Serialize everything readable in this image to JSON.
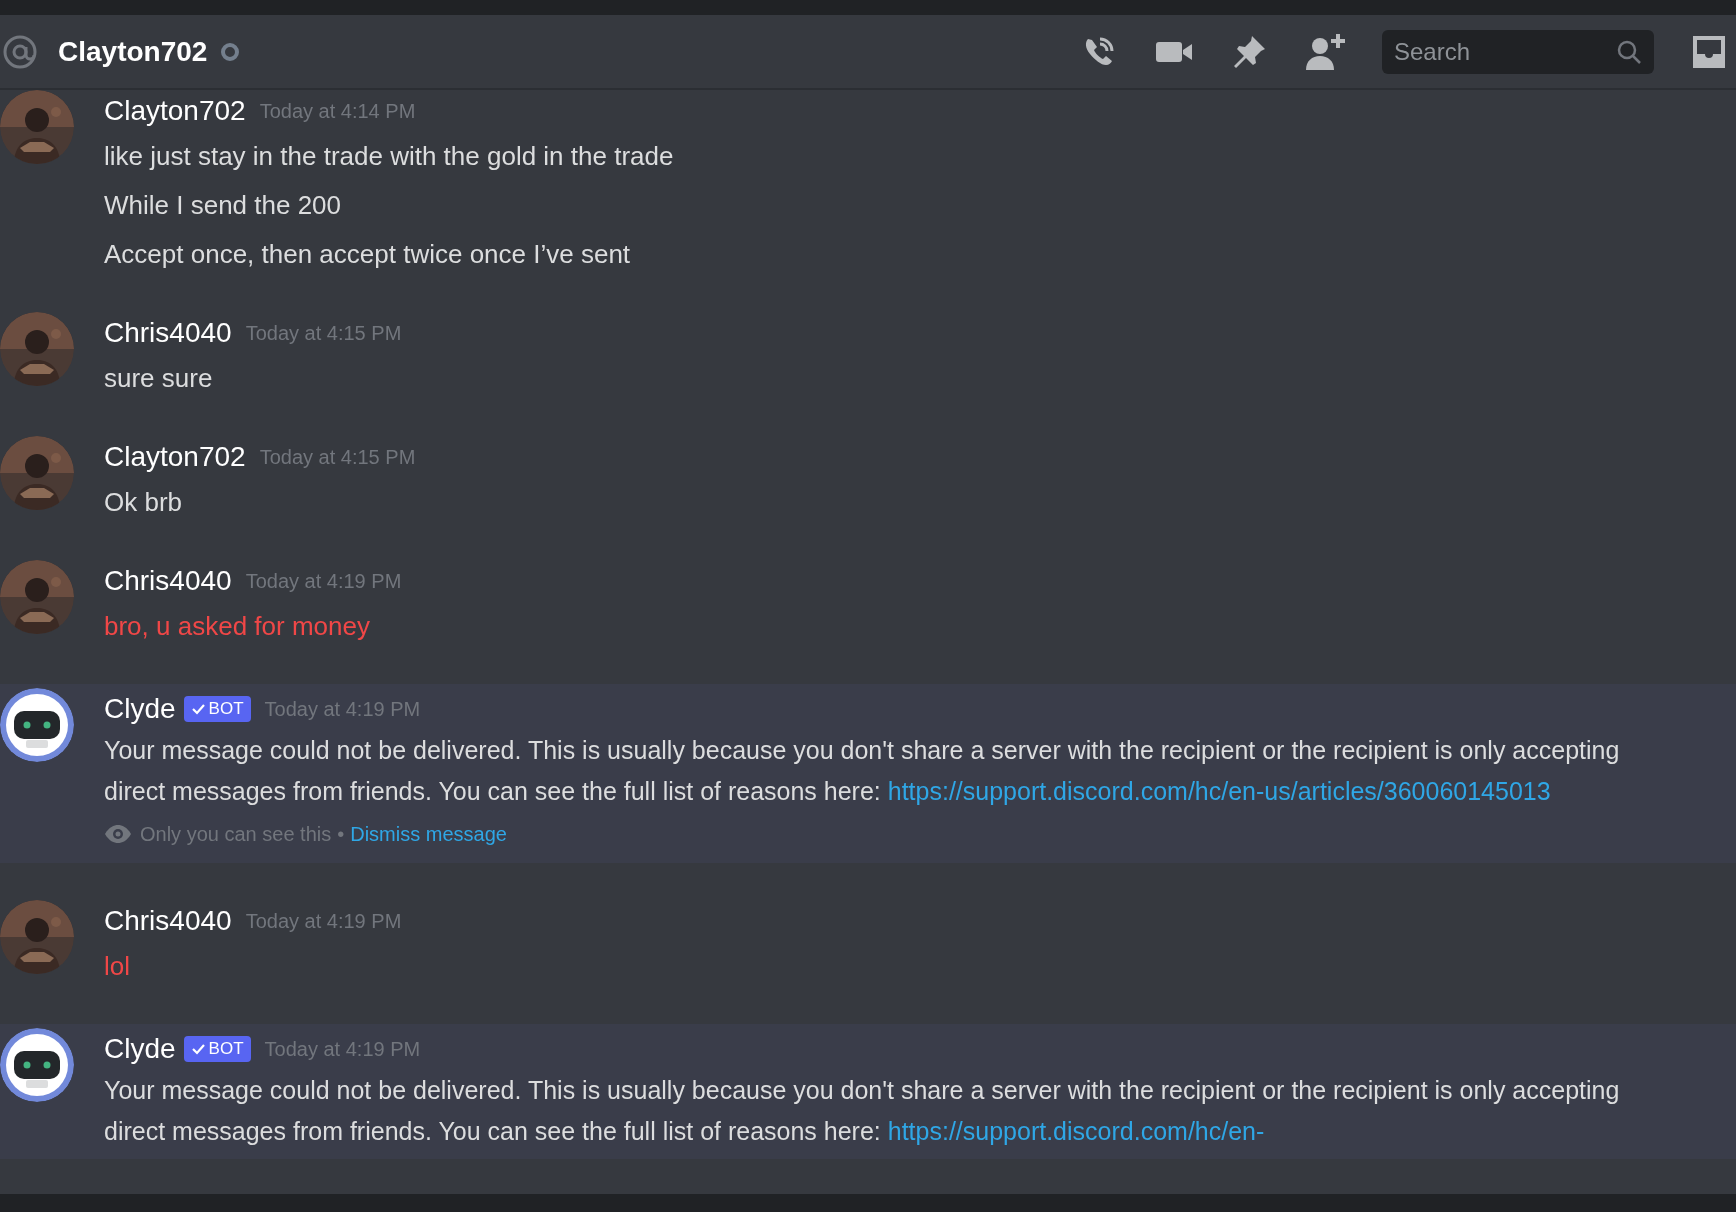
{
  "header": {
    "title": "Clayton702",
    "online": false,
    "search": {
      "placeholder": "Search"
    }
  },
  "messages": [
    {
      "author": "Clayton702",
      "time": "Today at 4:14 PM",
      "lines": [
        {
          "text": "like just stay in the trade with the gold in the trade"
        },
        {
          "text": "While I send the 200"
        },
        {
          "text": "Accept once, then accept twice once I’ve sent"
        }
      ]
    },
    {
      "author": "Chris4040",
      "time": "Today at 4:15 PM",
      "lines": [
        {
          "text": "sure sure"
        }
      ]
    },
    {
      "author": "Clayton702",
      "time": "Today at 4:15 PM",
      "lines": [
        {
          "text": "Ok brb"
        }
      ]
    },
    {
      "author": "Chris4040",
      "time": "Today at 4:19 PM",
      "lines": [
        {
          "text": "bro, u asked for money",
          "color": "#f04747"
        }
      ]
    },
    {
      "author": "Clyde",
      "avatar": {
        "kind": "bot"
      },
      "badge": "BOT",
      "time": "Today at 4:19 PM",
      "text": "Your message could not be delivered. This is usually because you don't share a server with the recipient or the recipient is only accepting direct messages from friends. You can see the full list of reasons here:",
      "link": "https://support.discord.com/hc/en-us/articles/360060145013",
      "ephemeral": {
        "text": "Only you can see this",
        "separator": "•",
        "action": "Dismiss message"
      }
    },
    {
      "author": "Chris4040",
      "time": "Today at 4:19 PM",
      "lines": [
        {
          "text": "lol",
          "color": "#f04747"
        }
      ]
    },
    {
      "author": "Clyde",
      "avatar": {
        "kind": "bot"
      },
      "badge": "BOT",
      "time": "Today at 4:19 PM",
      "text": "Your message could not be delivered. This is usually because you don't share a server with the recipient or the recipient is only accepting direct messages from friends. You can see the full list of reasons here:",
      "link": "https://support.discord.com/hc/en-"
    }
  ]
}
